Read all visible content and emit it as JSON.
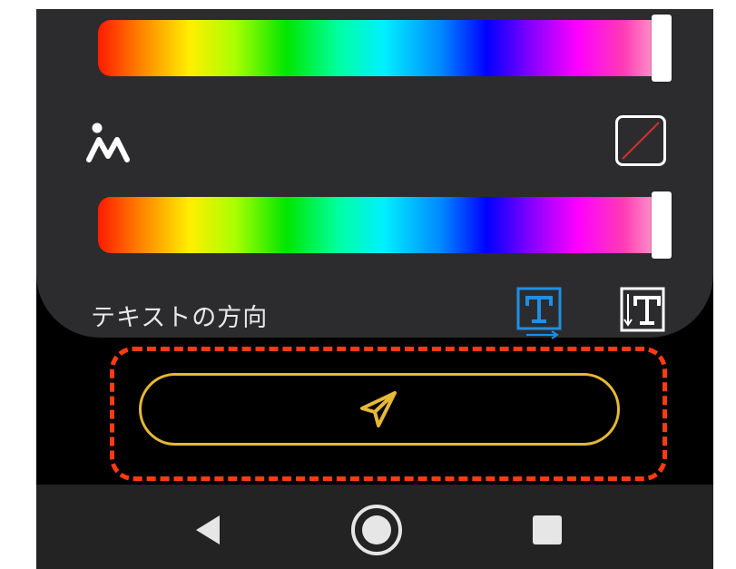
{
  "panel": {
    "text_direction_label": "テキストの方向"
  },
  "icons": {
    "opacity": "opacity-person-icon",
    "color_swatch": "no-color-swatch-icon",
    "horizontal_text": "text-horizontal-icon",
    "vertical_text": "text-vertical-icon",
    "send": "paper-plane-icon",
    "back": "back-triangle-icon",
    "home": "home-circle-icon",
    "recents": "recents-square-icon"
  },
  "colors": {
    "panel_bg": "#2c2c2e",
    "screen_bg": "#000000",
    "accent_blue": "#1e8fe6",
    "send_outline": "#e6b838",
    "highlight_dash": "#ff3b14",
    "nav_bar_bg": "#232323"
  },
  "state": {
    "selected_text_direction": "horizontal",
    "hue_slider_1": 1.0,
    "hue_slider_2": 1.0
  }
}
